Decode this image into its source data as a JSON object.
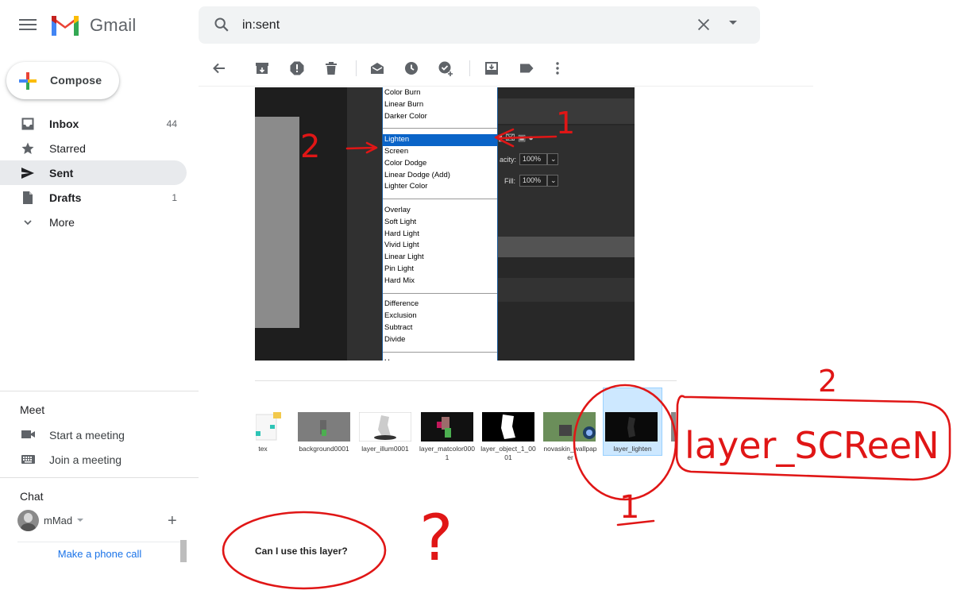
{
  "app": {
    "name": "Gmail"
  },
  "search": {
    "value": "in:sent"
  },
  "compose": {
    "label": "Compose"
  },
  "nav": [
    {
      "label": "Inbox",
      "count": "44",
      "bold": true
    },
    {
      "label": "Starred",
      "count": ""
    },
    {
      "label": "Sent",
      "count": "",
      "bold": true,
      "active": true
    },
    {
      "label": "Drafts",
      "count": "1",
      "bold": true
    },
    {
      "label": "More",
      "count": ""
    }
  ],
  "meet": {
    "title": "Meet",
    "start": "Start a meeting",
    "join": "Join a meeting"
  },
  "chat": {
    "title": "Chat",
    "user": "mMad",
    "phone": "Make a phone call"
  },
  "toolbar": {
    "icons": [
      "back-arrow-icon",
      "archive-icon",
      "report-spam-icon",
      "delete-icon",
      "mark-unread-icon",
      "snooze-icon",
      "add-task-icon",
      "move-to-icon",
      "label-icon",
      "more-vert-icon"
    ]
  },
  "blend_menu": {
    "items": [
      "Color Burn",
      "Linear Burn",
      "Darker Color",
      "---",
      "Lighten",
      "Screen",
      "Color Dodge",
      "Linear Dodge (Add)",
      "Lighter Color",
      "---",
      "Overlay",
      "Soft Light",
      "Hard Light",
      "Vivid Light",
      "Linear Light",
      "Pin Light",
      "Hard Mix",
      "---",
      "Difference",
      "Exclusion",
      "Subtract",
      "Divide",
      "---",
      "Hue"
    ],
    "selected": "Lighten",
    "opacity_label": "acity:",
    "opacity_value": "100%",
    "fill_label": "Fill:",
    "fill_value": "100%"
  },
  "attachments": [
    {
      "label": "tex"
    },
    {
      "label": "background0001"
    },
    {
      "label": "layer_illum0001"
    },
    {
      "label": "layer_matcolor0001"
    },
    {
      "label": "layer_object_1_0001"
    },
    {
      "label": "novaskin_wallpaper"
    },
    {
      "label": "layer_lighten",
      "selected": true
    }
  ],
  "message": {
    "question": "Can I use this layer?"
  },
  "annotations": {
    "left_note": "2",
    "menu_note": "1",
    "right_title_num": "2",
    "right_title": "layer_SCReeN",
    "bottom_num": "1",
    "question_mark": "?"
  },
  "colors": {
    "annotation_red": "#e01616",
    "gmail_red": "#EA4335",
    "selection_blue": "#0a64c8",
    "link_blue": "#1a73e8"
  }
}
